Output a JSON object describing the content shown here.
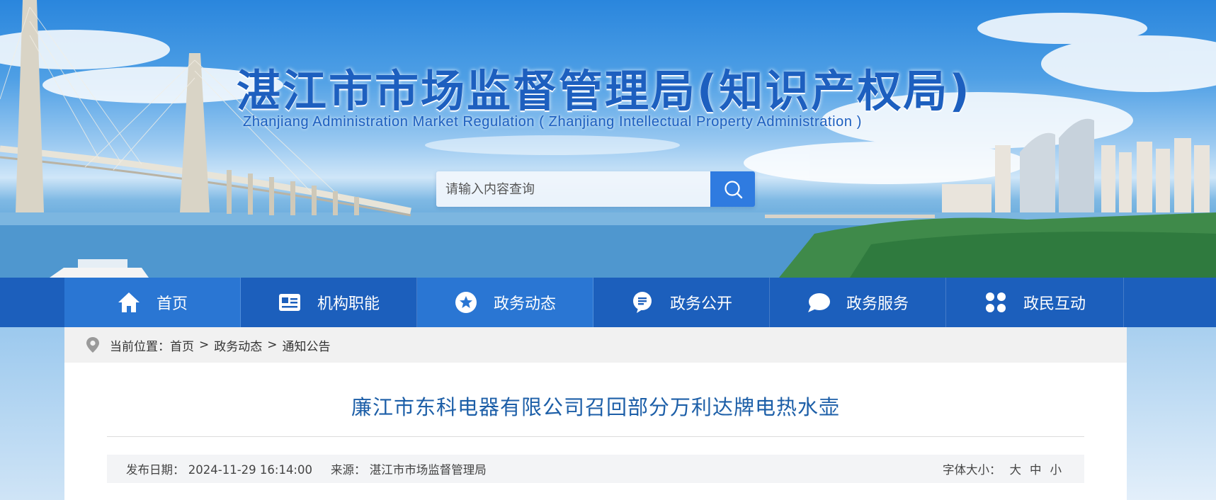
{
  "site": {
    "title_cn": "湛江市市场监督管理局(知识产权局)",
    "title_en": "Zhanjiang Administration Market Regulation ( Zhanjiang Intellectual Property Administration )"
  },
  "search": {
    "placeholder": "请输入内容查询",
    "icon": "search-icon"
  },
  "nav": {
    "items": [
      {
        "label": "首页",
        "icon": "home-icon"
      },
      {
        "label": "机构职能",
        "icon": "id-card-icon"
      },
      {
        "label": "政务动态",
        "icon": "star-badge-icon"
      },
      {
        "label": "政务公开",
        "icon": "document-bubble-icon"
      },
      {
        "label": "政务服务",
        "icon": "chat-bubble-icon"
      },
      {
        "label": "政民互动",
        "icon": "grid-petals-icon"
      }
    ],
    "active": "政务动态"
  },
  "breadcrumb": {
    "prefix": "当前位置：",
    "items": [
      "首页",
      "政务动态",
      "通知公告"
    ],
    "separator": ">"
  },
  "article": {
    "title": "廉江市东科电器有限公司召回部分万利达牌电热水壶",
    "pub_label": "发布日期：",
    "pub_date": "2024-11-29 16:14:00",
    "source_label": "来源：",
    "source": "湛江市市场监督管理局",
    "font_size_label": "字体大小：",
    "font_sizes": [
      "大",
      "中",
      "小"
    ]
  },
  "colors": {
    "nav_bg": "#1c5fbc",
    "nav_active": "#2a76d3",
    "title_blue": "#1d5fbf",
    "article_title": "#1d5fa8",
    "search_button": "#2f7be0"
  }
}
